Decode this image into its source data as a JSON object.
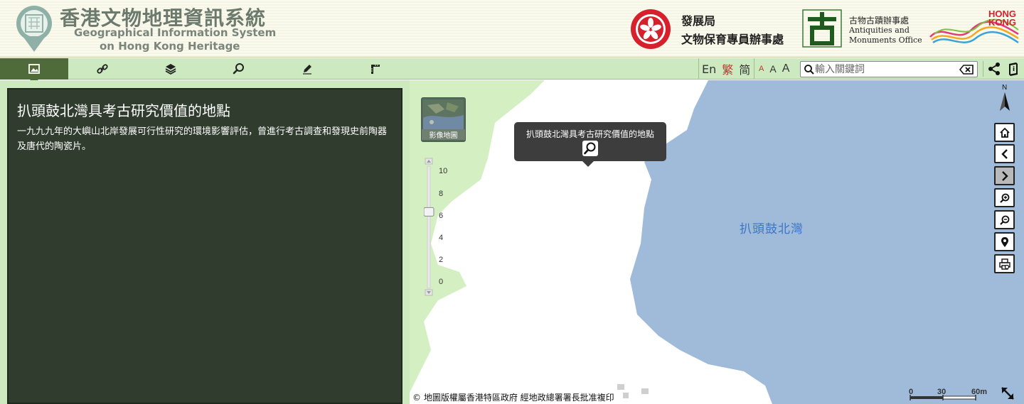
{
  "header": {
    "title_zh": "香港文物地理資訊系統",
    "title_en_line1": "Geographical Information System",
    "title_en_line2": "on Hong Kong Heritage",
    "devb_line1": "發展局",
    "devb_line2": "文物保育專員辦事處",
    "amo_zh": "古物古蹟辦事處",
    "amo_en_line1": "Antiquities and",
    "amo_en_line2": "Monuments Office",
    "brand_hk_line1": "HONG",
    "brand_hk_line2": "KONG"
  },
  "toolbar": {
    "tabs": [
      {
        "id": "info",
        "icon": "info-image-icon",
        "active": true
      },
      {
        "id": "link",
        "icon": "link-icon",
        "active": false
      },
      {
        "id": "layers",
        "icon": "layers-icon",
        "active": false
      },
      {
        "id": "search",
        "icon": "search-icon",
        "active": false
      },
      {
        "id": "draw",
        "icon": "pencil-icon",
        "active": false
      },
      {
        "id": "measure",
        "icon": "ruler-icon",
        "active": false
      }
    ],
    "lang_en": "En",
    "lang_tc": "繁",
    "lang_sc": "简",
    "font_small": "A",
    "font_medium": "A",
    "font_large": "A",
    "search_placeholder": "輸入關鍵詞"
  },
  "panel": {
    "title": "扒頭鼓北灣具考古研究價值的地點",
    "description": "一九九九年的大嶼山北岸發展可行性研究的環境影響評估，曾進行考古調查和發現史前陶器及唐代的陶瓷片。"
  },
  "map": {
    "imagery_label": "影像地圖",
    "zoom_labels": [
      "10",
      "8",
      "6",
      "4",
      "2",
      "0"
    ],
    "zoom_level": 6,
    "popup_title": "扒頭鼓北灣具考古研究價值的地點",
    "bay_label": "扒頭鼓北灣",
    "north_label": "N",
    "copyright": "© 地圖版權屬香港特區政府 經地政總署署長批准複印",
    "scale_labels": [
      "0",
      "30",
      "60m"
    ],
    "colors": {
      "water": "#9fbbd9",
      "vegetation": "#d4f0c2",
      "land": "#ffffff",
      "panel_dark": "#2f3c2e",
      "toolbar_green": "#cde9c0"
    }
  }
}
